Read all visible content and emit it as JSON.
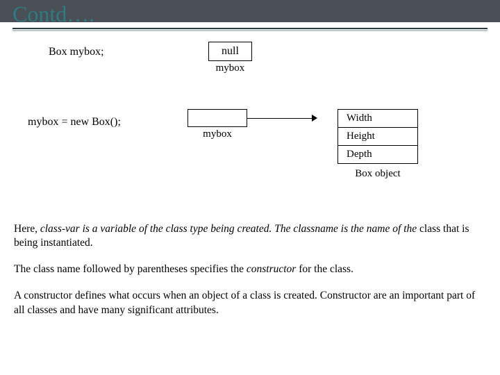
{
  "heading": "Contd….",
  "diagram": {
    "declaration": "Box mybox;",
    "null_label": "null",
    "var_caption": "mybox",
    "assignment": "mybox = new Box();",
    "fields": [
      "Width",
      "Height",
      "Depth"
    ],
    "object_caption": "Box object"
  },
  "para1_parts": {
    "a": "Here, ",
    "b": "class-var is a variable of the class type being created. The classname is the name of the ",
    "c": "class that is being instantiated."
  },
  "para2_parts": {
    "a": "The class name followed by parentheses specifies the ",
    "b": "constructor",
    "c": " for the class."
  },
  "para3": "A constructor defines what occurs when an object of a class is created. Constructor are an important part of all classes and have many significant attributes."
}
